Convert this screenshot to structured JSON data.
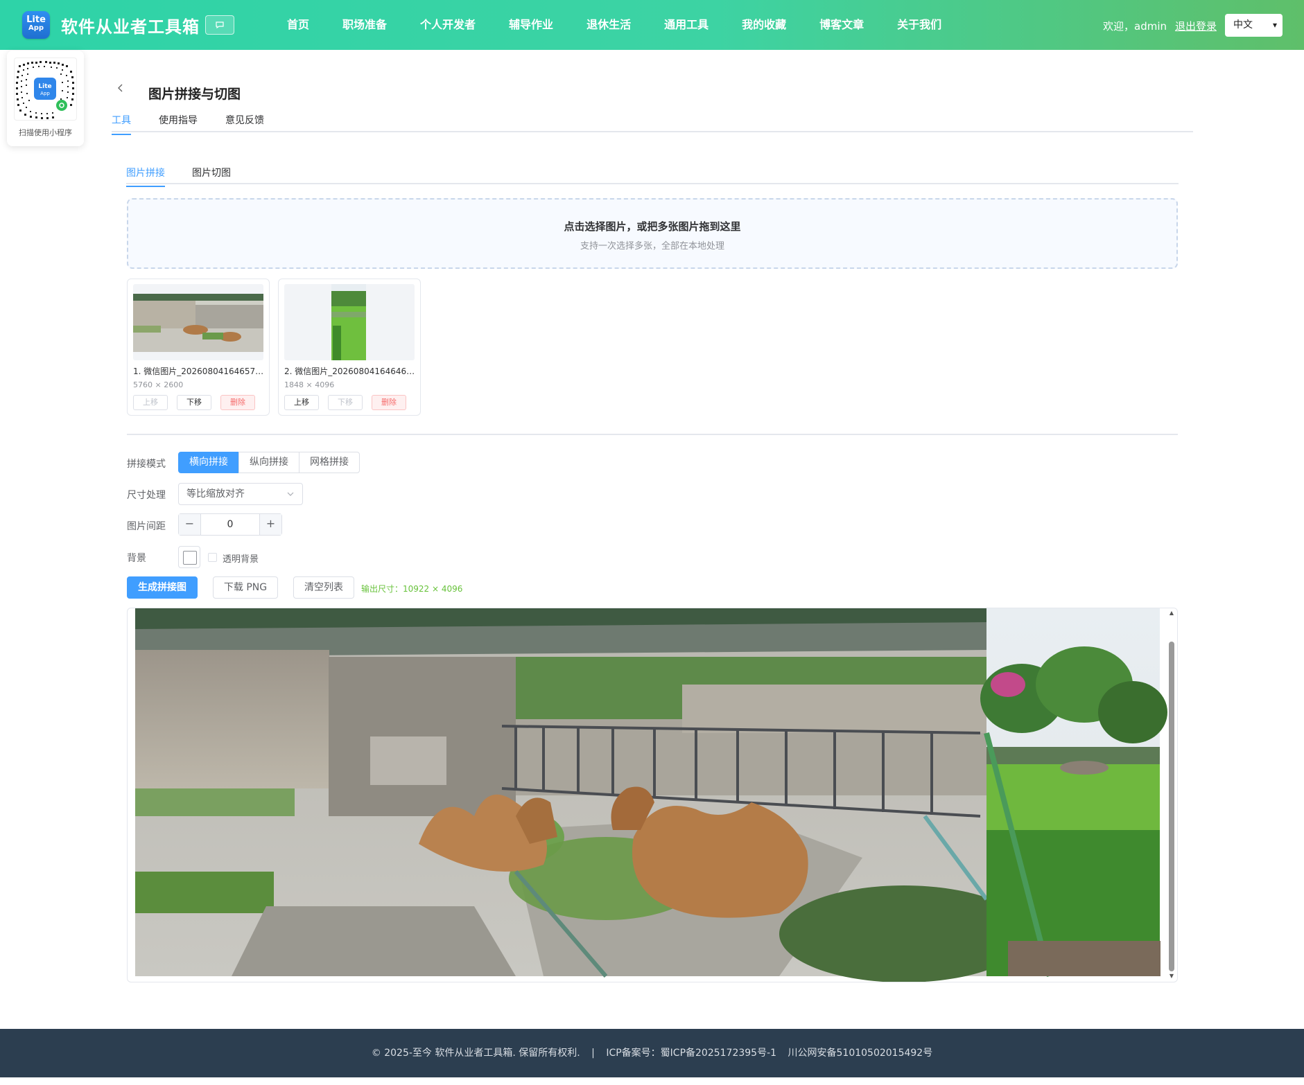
{
  "header": {
    "logo_line1": "Lite",
    "logo_line2": "App",
    "brand": "软件从业者工具箱",
    "chat_icon": "💬",
    "nav": [
      "首页",
      "职场准备",
      "个人开发者",
      "辅导作业",
      "退休生活",
      "通用工具",
      "我的收藏",
      "博客文章",
      "关于我们"
    ],
    "welcome": "欢迎，admin",
    "logout": "退出登录",
    "language": "中文"
  },
  "sidebar_qr": {
    "caption": "扫描使用小程序"
  },
  "page": {
    "title": "图片拼接与切图",
    "tabs": [
      "工具",
      "使用指导",
      "意见反馈"
    ],
    "active_tab": "工具"
  },
  "tool": {
    "subtabs": [
      "图片拼接",
      "图片切图"
    ],
    "active_subtab": "图片拼接",
    "dropzone": {
      "title": "点击选择图片，或把多张图片拖到这里",
      "hint": "支持一次选择多张，全部在本地处理"
    },
    "images": [
      {
        "name": "1. 微信图片_20260804164657…",
        "size": "5760 × 2600",
        "up": "上移",
        "down": "下移",
        "delete": "删除"
      },
      {
        "name": "2. 微信图片_20260804164646…",
        "size": "1848 × 4096",
        "up": "上移",
        "down": "下移",
        "delete": "删除"
      }
    ],
    "form": {
      "mode_label": "拼接模式",
      "modes": [
        "横向拼接",
        "纵向拼接",
        "网格拼接"
      ],
      "active_mode": "横向拼接",
      "size_label": "尺寸处理",
      "size_value": "等比缩放对齐",
      "gap_label": "图片间距",
      "gap_value": "0",
      "bg_label": "背景",
      "transparent_label": "透明背景",
      "transparent_checked": false
    },
    "actions": {
      "generate": "生成拼接图",
      "download": "下载 PNG",
      "clear": "清空列表",
      "output_size": "输出尺寸：10922 × 4096"
    }
  },
  "footer": {
    "copyright": "© 2025-至今 软件从业者工具箱. 保留所有权利.",
    "separator": "|",
    "icp": "ICP备案号：蜀ICP备2025172395号-1",
    "police": "川公网安备51010502015492号"
  },
  "colors": {
    "header_gradient_start": "#2ed3a8",
    "header_gradient_end": "#5fbf6a",
    "accent": "#409eff",
    "danger": "#f56c6c",
    "success": "#67c23a",
    "footer_bg": "#2c3e50"
  },
  "icons": {
    "back": "chevron-left-icon",
    "chat": "chat-bubble-icon",
    "select_arrow": "chevron-down-icon",
    "minus": "minus-icon",
    "plus": "plus-icon"
  }
}
